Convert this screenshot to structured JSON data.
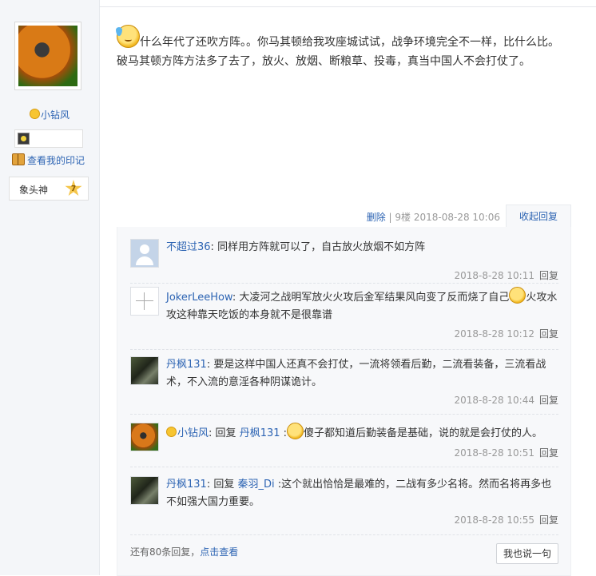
{
  "author": {
    "name": "小钻风",
    "view_marks": "查看我的印记",
    "rank_title": "象头神",
    "rank_level": "7"
  },
  "post": {
    "line1": "什么年代了还吹方阵。。你马其顿给我攻座城试试，战争环境完全不一样，比什么比。",
    "line2": "破马其顿方阵方法多了去了，放火、放烟、断粮草、投毒，真当中国人不会打仗了。",
    "delete": "删除",
    "floor": "9楼",
    "datetime": "2018-08-28 10:06",
    "fold_replies": "收起回复"
  },
  "replies": [
    {
      "user": "不超过36",
      "text": "同样用方阵就可以了，自古放火放烟不如方阵",
      "time": "2018-8-28 10:11",
      "reply": "回复"
    },
    {
      "user": "JokerLeeHow",
      "text_a": "大凌河之战明军放火火攻后金军结果风向变了反而烧了自己",
      "text_b": "火攻水攻这种靠天吃饭的本身就不是很靠谱",
      "time": "2018-8-28 10:12",
      "reply": "回复"
    },
    {
      "user": "丹枫131",
      "text": "要是这样中国人还真不会打仗，一流将领看后勤，二流看装备，三流看战术，不入流的意淫各种阴谋诡计。",
      "time": "2018-8-28 10:44",
      "reply": "回复"
    },
    {
      "user": "小钻风",
      "prefix": "回复",
      "target": "丹枫131",
      "text": "傻子都知道后勤装备是基础，说的就是会打仗的人。",
      "time": "2018-8-28 10:51",
      "reply": "回复"
    },
    {
      "user": "丹枫131",
      "prefix": "回复",
      "target": "秦羽_Di",
      "text": ":这个就出恰恰是最难的，二战有多少名将。然而名将再多也不如强大国力重要。",
      "time": "2018-8-28 10:55",
      "reply": "回复"
    }
  ],
  "footer": {
    "more_text": "还有80条回复，",
    "more_link": "点击查看",
    "say_button": "我也说一句"
  }
}
